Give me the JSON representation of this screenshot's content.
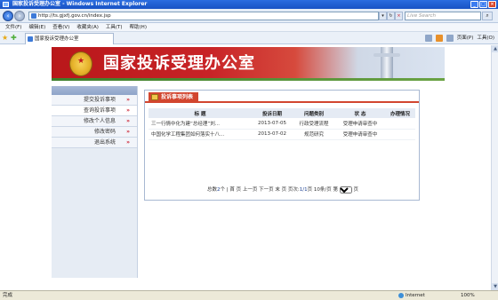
{
  "window": {
    "title": "国家投诉受理办公室 - Windows Internet Explorer"
  },
  "address_bar": {
    "url": "http://ts.gjxfj.gov.cn/index.jsp",
    "search_placeholder": "Live Search"
  },
  "menu": [
    "文件(F)",
    "编辑(E)",
    "查看(V)",
    "收藏夹(A)",
    "工具(T)",
    "帮助(H)"
  ],
  "tab": {
    "label": "国家投诉受理办公室"
  },
  "tools": {
    "page": "页面(P)",
    "tools": "工具(O)"
  },
  "banner": {
    "title": "国家投诉受理办公室"
  },
  "sidebar": {
    "items": [
      {
        "label": "提交投诉事项"
      },
      {
        "label": "查询投诉事项"
      },
      {
        "label": "修改个人信息"
      },
      {
        "label": "修改密码"
      },
      {
        "label": "退出系统"
      }
    ],
    "chevron": "»"
  },
  "panel": {
    "title": "投诉事项列表",
    "columns": [
      "标  题",
      "投诉日期",
      "问题类别",
      "状  态",
      "办理情况"
    ],
    "rows": [
      {
        "title": "三一行情中化为建“总经理”刘...",
        "date": "2013-07-05",
        "category": "行政受理流程",
        "status": "受理申请审查中",
        "handling": ""
      },
      {
        "title": "中国化学工程集团如何落实十八...",
        "date": "2013-07-02",
        "category": "规范研究",
        "status": "受理申请审查中",
        "handling": ""
      }
    ]
  },
  "pager": {
    "total_prefix": "总数",
    "total_count": "2",
    "total_suffix": "个",
    "first": "首 页",
    "prev": "上一页",
    "next": "下一页",
    "last": "末 页",
    "page_label": "页次:",
    "page_current": "1/1",
    "page_suffix": "页",
    "per_page": "10条/页",
    "goto_prefix": "第",
    "goto_value": "1",
    "goto_suffix": "页"
  },
  "status_bar": {
    "text": "完成",
    "zone": "Internet",
    "zoom": "100%"
  }
}
